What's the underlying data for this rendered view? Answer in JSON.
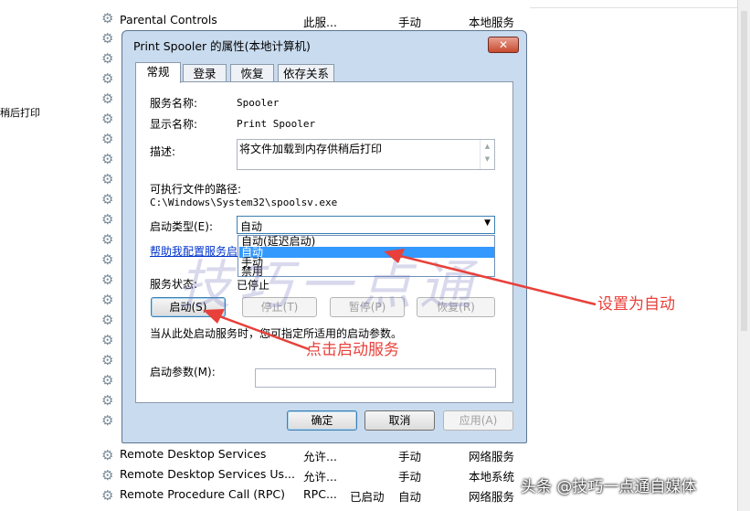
{
  "background": {
    "side_fragment": "稍后打印",
    "services_top": [
      {
        "name": "Parental Controls",
        "desc": "此服...",
        "state": "",
        "startup": "手动",
        "logon": "本地服务"
      }
    ],
    "services_bottom": [
      {
        "name": "Remote Desktop Services",
        "desc": "允许...",
        "state": "",
        "startup": "手动",
        "logon": "网络服务"
      },
      {
        "name": "Remote Desktop Services Us...",
        "desc": "允许...",
        "state": "",
        "startup": "手动",
        "logon": "本地系统"
      },
      {
        "name": "Remote Procedure Call (RPC)",
        "desc": "RPC...",
        "state": "已启动",
        "startup": "自动",
        "logon": "网络服务"
      }
    ]
  },
  "dialog": {
    "title": "Print Spooler 的属性(本地计算机)",
    "close_label": "✕",
    "tabs": [
      "常规",
      "登录",
      "恢复",
      "依存关系"
    ],
    "service_name_label": "服务名称:",
    "service_name": "Spooler",
    "display_name_label": "显示名称:",
    "display_name": "Print Spooler",
    "description_label": "描述:",
    "description": "将文件加载到内存供稍后打印",
    "exe_path_label": "可执行文件的路径:",
    "exe_path": "C:\\Windows\\System32\\spoolsv.exe",
    "startup_type_label": "启动类型(E):",
    "startup_type_value": "自动",
    "startup_options": [
      "自动(延迟启动)",
      "自动",
      "手动",
      "禁用"
    ],
    "selected_option_index": 1,
    "help_link": "帮助我配置服务启",
    "status_label": "服务状态:",
    "status_value": "已停止",
    "buttons": {
      "start": "启动(S)",
      "stop": "停止(T)",
      "pause": "暂停(P)",
      "resume": "恢复(R)"
    },
    "hint_text": "当从此处启动服务时，您可指定所适用的启动参数。",
    "start_params_label": "启动参数(M):",
    "start_params_value": "",
    "ok": "确定",
    "cancel": "取消",
    "apply": "应用(A)"
  },
  "annotations": {
    "set_auto": "设置为自动",
    "click_start": "点击启动服务",
    "color": "#e8403a"
  },
  "watermark": {
    "source": "头条 @技巧一点通自媒体",
    "art": "技巧一点通"
  }
}
